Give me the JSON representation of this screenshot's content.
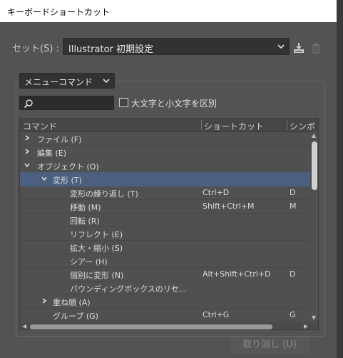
{
  "window": {
    "title": "キーボードショートカット"
  },
  "set": {
    "label": "セット(S) :",
    "value": "Illustrator 初期設定"
  },
  "mode": {
    "value": "メニューコマンド"
  },
  "search": {
    "placeholder": ""
  },
  "case_option": {
    "label": "大文字と小文字を区別",
    "checked": false
  },
  "table": {
    "headers": {
      "command": "コマンド",
      "shortcut": "ショートカット",
      "symbol": "シンボ"
    },
    "rows": [
      {
        "command": "ファイル (F)",
        "shortcut": "",
        "symbol": "",
        "expander": "collapsed"
      },
      {
        "command": "編集 (E)",
        "shortcut": "",
        "symbol": "",
        "expander": "collapsed"
      },
      {
        "command": "オブジェクト (O)",
        "shortcut": "",
        "symbol": "",
        "expander": "expanded"
      },
      {
        "command": "変形 (T)",
        "shortcut": "",
        "symbol": "",
        "expander": "expanded",
        "selected": true
      },
      {
        "command": "変形の繰り返し (T)",
        "shortcut": "Ctrl+D",
        "symbol": "D"
      },
      {
        "command": "移動 (M)",
        "shortcut": "Shift+Ctrl+M",
        "symbol": "M"
      },
      {
        "command": "回転 (R)",
        "shortcut": "",
        "symbol": ""
      },
      {
        "command": "リフレクト (E)",
        "shortcut": "",
        "symbol": ""
      },
      {
        "command": "拡大・縮小 (S)",
        "shortcut": "",
        "symbol": ""
      },
      {
        "command": "シアー (H)",
        "shortcut": "",
        "symbol": ""
      },
      {
        "command": "個別に変形 (N)",
        "shortcut": "Alt+Shift+Ctrl+D",
        "symbol": "D"
      },
      {
        "command": "バウンディングボックスのリセ...",
        "shortcut": "",
        "symbol": ""
      },
      {
        "command": "重ね順 (A)",
        "shortcut": "",
        "symbol": "",
        "expander": "collapsed"
      },
      {
        "command": "グループ (G)",
        "shortcut": "Ctrl+G",
        "symbol": "G"
      }
    ]
  },
  "buttons": {
    "undo": "取り消し (U)"
  },
  "icons": {
    "save": "save-set-icon",
    "delete": "delete-set-icon",
    "search": "search-icon",
    "dropdown": "chevron-down-icon"
  },
  "colors": {
    "selection": "#4b6080",
    "panel": "#535353",
    "field": "#323232"
  }
}
